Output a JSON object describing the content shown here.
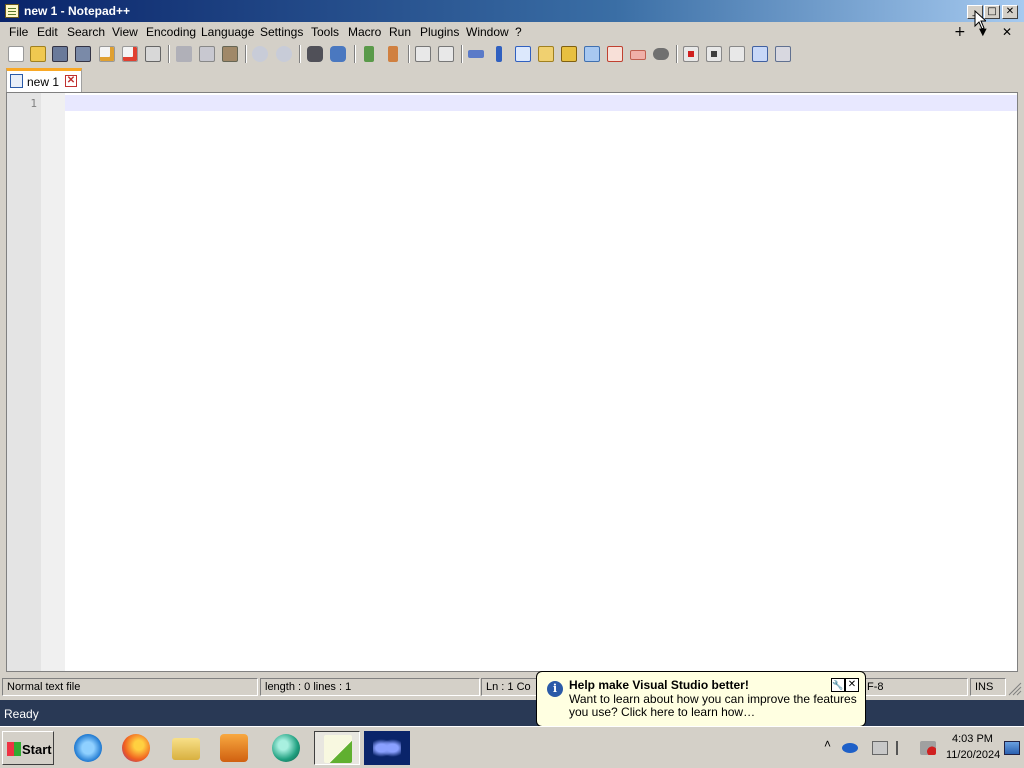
{
  "window": {
    "title": "new 1 - Notepad++"
  },
  "menu": {
    "items": [
      "File",
      "Edit",
      "Search",
      "View",
      "Encoding",
      "Language",
      "Settings",
      "Tools",
      "Macro",
      "Run",
      "Plugins",
      "Window",
      "?"
    ],
    "new_tab_glyph": "+",
    "dropdown_glyph": "▼",
    "close_glyph": "✕"
  },
  "tabs": [
    {
      "label": "new 1",
      "close": "✕"
    }
  ],
  "editor": {
    "line_numbers": [
      "1"
    ],
    "content": ""
  },
  "statusbar": {
    "file_type": "Normal text file",
    "length_lines": "length : 0    lines : 1",
    "position": "Ln : 1    Co",
    "encoding": "F-8",
    "mode": "INS"
  },
  "vs_status": {
    "ready": "Ready"
  },
  "balloon": {
    "title": "Help make Visual Studio better!",
    "text": "Want to learn about how you can improve the features you use? Click here to learn how…",
    "options_glyph": "🔧",
    "close_glyph": "✕"
  },
  "taskbar": {
    "start_label": "Start",
    "clock_time": "4:03 PM",
    "clock_date": "11/20/2024"
  },
  "colors": {
    "title_gradient_start": "#0a246a",
    "vs_status_bg": "#293955",
    "balloon_bg": "#ffffe1",
    "tab_accent": "#f9a825"
  }
}
